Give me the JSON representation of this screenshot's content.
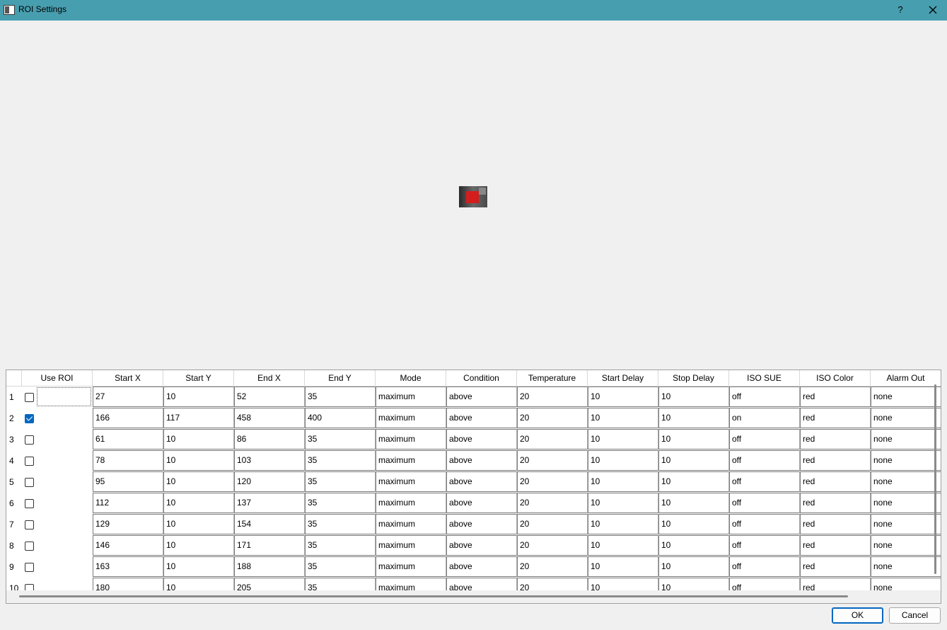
{
  "window": {
    "title": "ROI Settings",
    "help_label": "?",
    "app_icon": "window-icon",
    "close_icon": "close-icon"
  },
  "table": {
    "columns": [
      "Use ROI",
      "Start X",
      "Start Y",
      "End X",
      "End Y",
      "Mode",
      "Condition",
      "Temperature",
      "Start Delay",
      "Stop Delay",
      "ISO SUE",
      "ISO Color",
      "Alarm Out"
    ],
    "rows": [
      {
        "num": "1",
        "use": false,
        "values": [
          "27",
          "10",
          "52",
          "35",
          "maximum",
          "above",
          "20",
          "10",
          "10",
          "off",
          "red",
          "none"
        ]
      },
      {
        "num": "2",
        "use": true,
        "values": [
          "166",
          "117",
          "458",
          "400",
          "maximum",
          "above",
          "20",
          "10",
          "10",
          "on",
          "red",
          "none"
        ]
      },
      {
        "num": "3",
        "use": false,
        "values": [
          "61",
          "10",
          "86",
          "35",
          "maximum",
          "above",
          "20",
          "10",
          "10",
          "off",
          "red",
          "none"
        ]
      },
      {
        "num": "4",
        "use": false,
        "values": [
          "78",
          "10",
          "103",
          "35",
          "maximum",
          "above",
          "20",
          "10",
          "10",
          "off",
          "red",
          "none"
        ]
      },
      {
        "num": "5",
        "use": false,
        "values": [
          "95",
          "10",
          "120",
          "35",
          "maximum",
          "above",
          "20",
          "10",
          "10",
          "off",
          "red",
          "none"
        ]
      },
      {
        "num": "6",
        "use": false,
        "values": [
          "112",
          "10",
          "137",
          "35",
          "maximum",
          "above",
          "20",
          "10",
          "10",
          "off",
          "red",
          "none"
        ]
      },
      {
        "num": "7",
        "use": false,
        "values": [
          "129",
          "10",
          "154",
          "35",
          "maximum",
          "above",
          "20",
          "10",
          "10",
          "off",
          "red",
          "none"
        ]
      },
      {
        "num": "8",
        "use": false,
        "values": [
          "146",
          "10",
          "171",
          "35",
          "maximum",
          "above",
          "20",
          "10",
          "10",
          "off",
          "red",
          "none"
        ]
      },
      {
        "num": "9",
        "use": false,
        "values": [
          "163",
          "10",
          "188",
          "35",
          "maximum",
          "above",
          "20",
          "10",
          "10",
          "off",
          "red",
          "none"
        ]
      },
      {
        "num": "10",
        "use": false,
        "values": [
          "180",
          "10",
          "205",
          "35",
          "maximum",
          "above",
          "20",
          "10",
          "10",
          "off",
          "red",
          "none"
        ]
      }
    ]
  },
  "buttons": {
    "ok_label": "OK",
    "cancel_label": "Cancel"
  },
  "colors": {
    "titlebar": "#479eaf",
    "roi_marker": "#d41d1d",
    "checkbox_checked": "#0067c0"
  }
}
